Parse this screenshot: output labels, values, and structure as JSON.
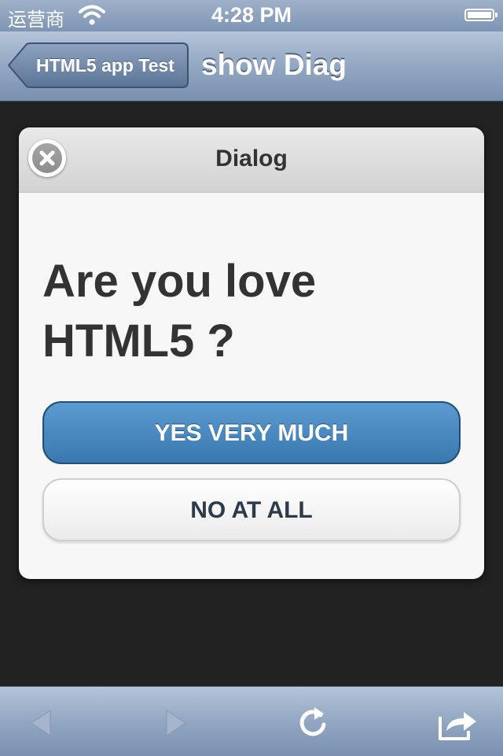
{
  "status_bar": {
    "carrier": "运营商",
    "time": "4:28 PM",
    "wifi_icon": "wifi-icon",
    "battery_icon": "battery-icon"
  },
  "nav_bar": {
    "back_label": "HTML5 app Test",
    "title": "show Diag"
  },
  "dialog": {
    "title": "Dialog",
    "close_icon": "close-icon",
    "question": "Are you love HTML5 ?",
    "yes_label": "YES VERY MUCH",
    "no_label": "NO AT ALL",
    "yes_color": "#3f7fb8"
  },
  "toolbar": {
    "icons": [
      "back-arrow-icon",
      "forward-arrow-icon",
      "reload-icon",
      "share-icon"
    ]
  }
}
